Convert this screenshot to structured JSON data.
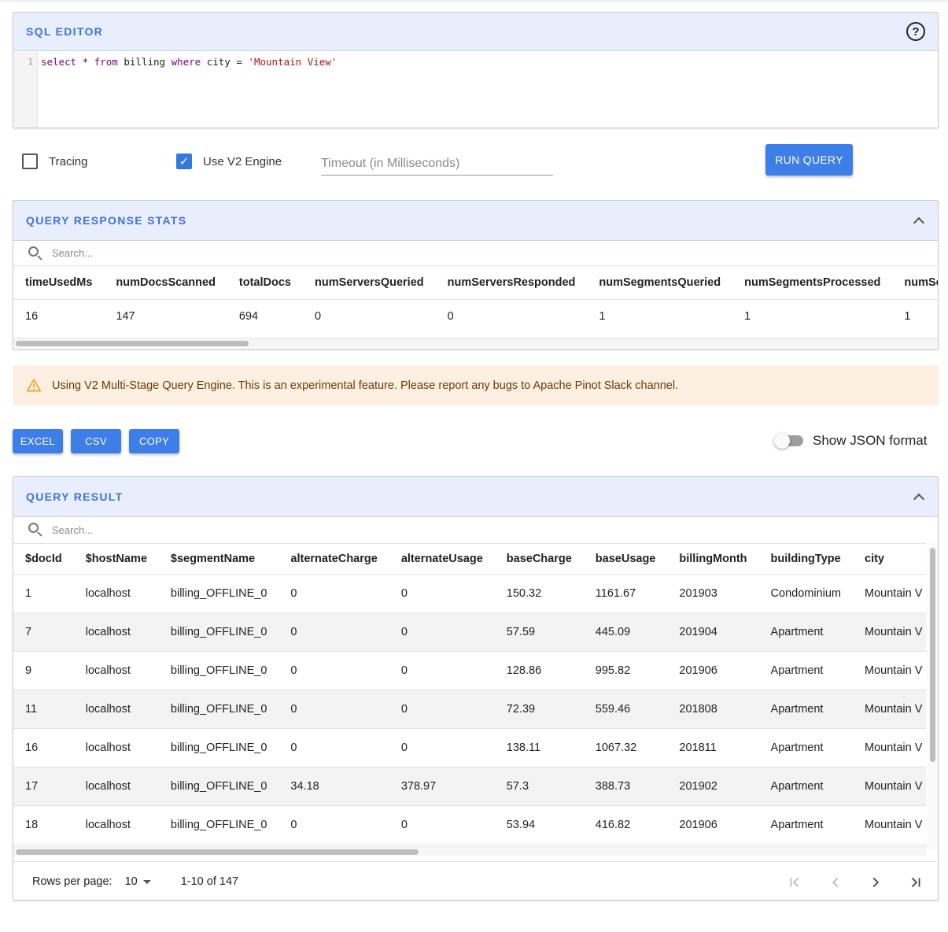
{
  "sql_editor": {
    "title": "SQL EDITOR",
    "line_number": "1",
    "code": {
      "select_kw": "select",
      "star": " * ",
      "from_kw": "from",
      "table": " billing ",
      "where_kw": "where",
      "condition": " city = ",
      "literal": "'Mountain View'"
    },
    "help_icon": "help-circle-icon"
  },
  "options": {
    "tracing_label": "Tracing",
    "tracing_checked": false,
    "v2_label": "Use V2 Engine",
    "v2_checked": true,
    "timeout_placeholder": "Timeout (in Milliseconds)",
    "timeout_value": "",
    "run_query_label": "RUN QUERY"
  },
  "stats": {
    "title": "QUERY RESPONSE STATS",
    "search_placeholder": "Search...",
    "columns": [
      "timeUsedMs",
      "numDocsScanned",
      "totalDocs",
      "numServersQueried",
      "numServersResponded",
      "numSegmentsQueried",
      "numSegmentsProcessed",
      "numSeg"
    ],
    "row": [
      "16",
      "147",
      "694",
      "0",
      "0",
      "1",
      "1",
      "1"
    ]
  },
  "warning": {
    "icon": "warning-triangle-icon",
    "text": "Using V2 Multi-Stage Query Engine. This is an experimental feature. Please report any bugs to Apache Pinot Slack channel."
  },
  "export": {
    "excel_label": "EXCEL",
    "csv_label": "CSV",
    "copy_label": "COPY"
  },
  "json_toggle": {
    "label": "Show JSON format",
    "on": false
  },
  "result": {
    "title": "QUERY RESULT",
    "search_placeholder": "Search...",
    "columns": [
      "$docId",
      "$hostName",
      "$segmentName",
      "alternateCharge",
      "alternateUsage",
      "baseCharge",
      "baseUsage",
      "billingMonth",
      "buildingType",
      "city"
    ],
    "rows": [
      [
        "1",
        "localhost",
        "billing_OFFLINE_0",
        "0",
        "0",
        "150.32",
        "1161.67",
        "201903",
        "Condominium",
        "Mountain V"
      ],
      [
        "7",
        "localhost",
        "billing_OFFLINE_0",
        "0",
        "0",
        "57.59",
        "445.09",
        "201904",
        "Apartment",
        "Mountain V"
      ],
      [
        "9",
        "localhost",
        "billing_OFFLINE_0",
        "0",
        "0",
        "128.86",
        "995.82",
        "201906",
        "Apartment",
        "Mountain V"
      ],
      [
        "11",
        "localhost",
        "billing_OFFLINE_0",
        "0",
        "0",
        "72.39",
        "559.46",
        "201808",
        "Apartment",
        "Mountain V"
      ],
      [
        "16",
        "localhost",
        "billing_OFFLINE_0",
        "0",
        "0",
        "138.11",
        "1067.32",
        "201811",
        "Apartment",
        "Mountain V"
      ],
      [
        "17",
        "localhost",
        "billing_OFFLINE_0",
        "34.18",
        "378.97",
        "57.3",
        "388.73",
        "201902",
        "Apartment",
        "Mountain V"
      ],
      [
        "18",
        "localhost",
        "billing_OFFLINE_0",
        "0",
        "0",
        "53.94",
        "416.82",
        "201906",
        "Apartment",
        "Mountain V"
      ]
    ],
    "pagination": {
      "rows_per_page_label": "Rows per page:",
      "rows_per_page_value": "10",
      "range": "1-10 of 147"
    }
  },
  "colors": {
    "accent": "#3d7ee8",
    "panel_header_bg": "#e8eefb",
    "panel_title": "#3f73d9",
    "warning_bg": "#fdf0e2",
    "warning_icon": "#f0a020"
  }
}
